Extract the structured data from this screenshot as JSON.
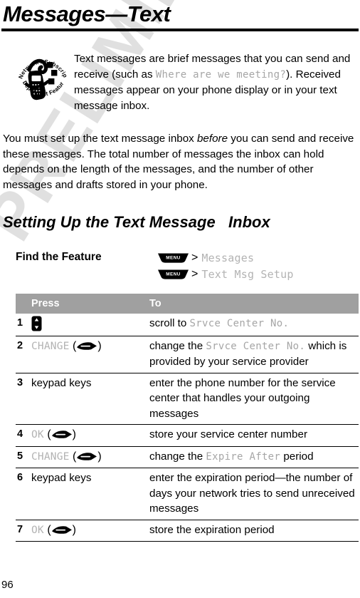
{
  "page": {
    "title": "Messages—Text",
    "number": "96"
  },
  "badge": {
    "icon_name": "network-subscription-dependent-feature-icon",
    "top_text": "Network / Subscription",
    "bottom_text": "Dependent  Feature"
  },
  "intro": {
    "part1": "Text messages are brief messages that you can send and receive (such as ",
    "example": "Where are we meeting?",
    "part2": ").",
    "part3": "Received messages appear on your phone display or in your text message inbox."
  },
  "inbox_para": {
    "part1": "You must set up the text message inbox ",
    "emphasis": "before",
    "part2": " you can send and receive these messages. The total number of messages the inbox can hold depends on the length of the messages, and the number of other messages and drafts stored in your phone."
  },
  "section": {
    "heading": "Setting Up the Text Message   Inbox"
  },
  "find_feature": {
    "label": "Find the Feature",
    "steps": [
      {
        "key": "MENU",
        "separator": ">",
        "target": "Messages"
      },
      {
        "key": "MENU",
        "separator": ">",
        "target": "Text Msg Setup"
      }
    ]
  },
  "table": {
    "headers": {
      "num": "",
      "press": "Press",
      "to": "To"
    },
    "rows": [
      {
        "num": "1",
        "press_type": "scroll-key",
        "press_label": "",
        "press_suffix": "",
        "to_prefix": "scroll to ",
        "to_mono": "Srvce Center No.",
        "to_suffix": ""
      },
      {
        "num": "2",
        "press_type": "softkey",
        "press_label": "CHANGE",
        "press_suffix": "",
        "to_prefix": "change the ",
        "to_mono": "Srvce Center No.",
        "to_suffix": " which is provided by your service provider"
      },
      {
        "num": "3",
        "press_type": "text",
        "press_label": "keypad keys",
        "press_suffix": "",
        "to_prefix": "enter the phone number for the service center that handles your outgoing messages",
        "to_mono": "",
        "to_suffix": ""
      },
      {
        "num": "4",
        "press_type": "softkey",
        "press_label": "OK",
        "press_suffix": "",
        "to_prefix": "store your service center number",
        "to_mono": "",
        "to_suffix": ""
      },
      {
        "num": "5",
        "press_type": "softkey",
        "press_label": "CHANGE",
        "press_suffix": "",
        "to_prefix": "change the ",
        "to_mono": "Expire After",
        "to_suffix": " period"
      },
      {
        "num": "6",
        "press_type": "text",
        "press_label": "keypad keys",
        "press_suffix": "",
        "to_prefix": "enter the expiration period—the number of days your network tries to send unreceived messages",
        "to_mono": "",
        "to_suffix": ""
      },
      {
        "num": "7",
        "press_type": "softkey",
        "press_label": "OK",
        "press_suffix": "",
        "to_prefix": "store the expiration period",
        "to_mono": "",
        "to_suffix": ""
      }
    ]
  },
  "watermark": {
    "text": "PRELIMINARY"
  },
  "colors": {
    "table_header_bg": "#a0a0a0",
    "mono_gray": "#a6a6a6",
    "watermark_gray": "#e0e0e0",
    "rule_black": "#000000"
  }
}
